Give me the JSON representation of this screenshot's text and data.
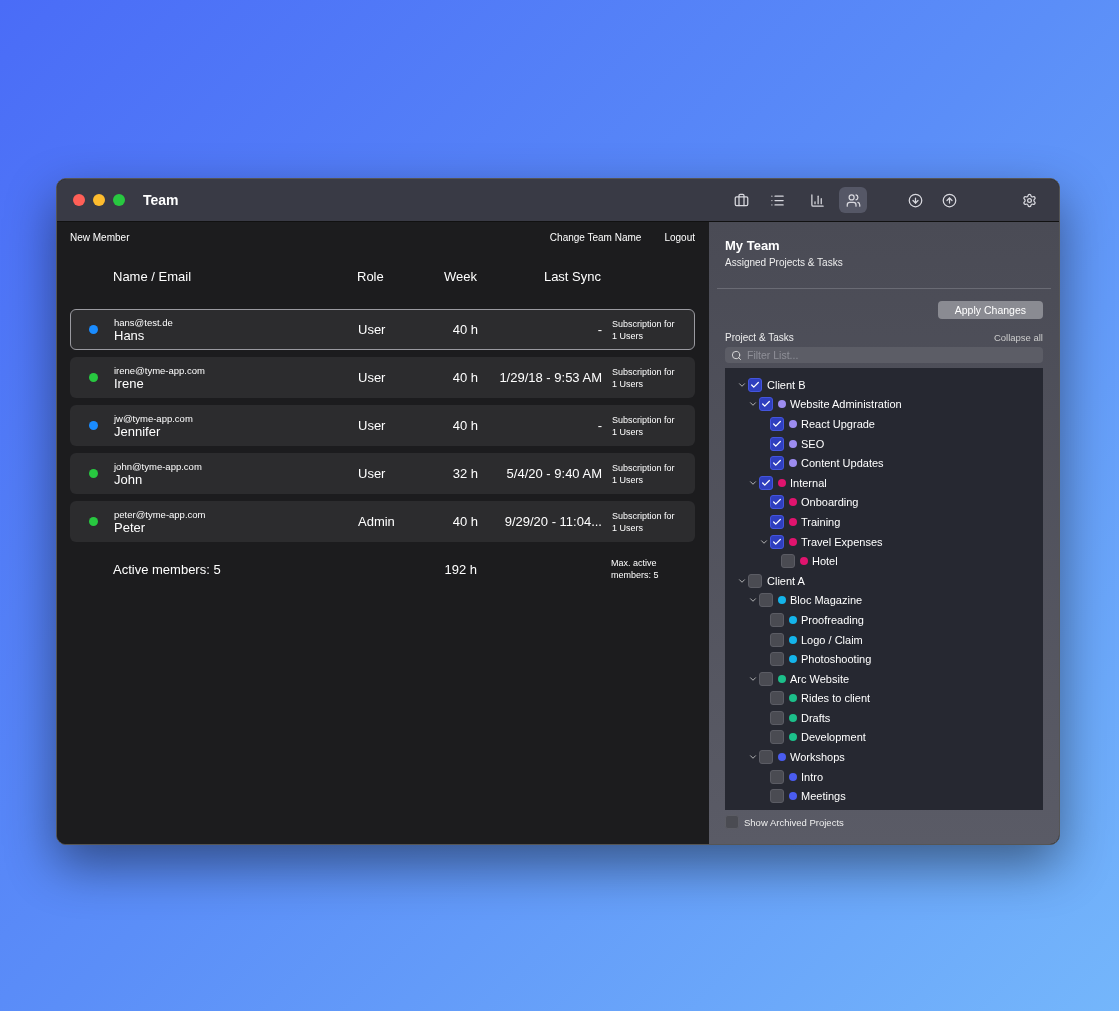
{
  "window": {
    "title": "Team"
  },
  "toolbar": [
    {
      "kind": "briefcase",
      "selected": false
    },
    {
      "kind": "list",
      "selected": false
    },
    {
      "kind": "chart",
      "selected": false
    },
    {
      "kind": "team",
      "selected": true
    },
    {
      "kind": "download",
      "selected": false
    },
    {
      "kind": "upload",
      "selected": false
    },
    {
      "kind": "settings",
      "selected": false
    }
  ],
  "team_actions": {
    "new_member": "New Member",
    "change_name": "Change Team Name",
    "logout": "Logout"
  },
  "table": {
    "columns": [
      "Name / Email",
      "Role",
      "Week",
      "Last Sync"
    ],
    "rows": [
      {
        "email": "hans@test.de",
        "name": "Hans",
        "role": "User",
        "week": "40 h",
        "last_sync": "-",
        "subscription": "Subscription for 1 Users",
        "color": "#1a8cff",
        "selected": true
      },
      {
        "email": "irene@tyme-app.com",
        "name": "Irene",
        "role": "User",
        "week": "40 h",
        "last_sync": "1/29/18 - 9:53 AM",
        "subscription": "Subscription for 1 Users",
        "color": "#28c840",
        "selected": false
      },
      {
        "email": "jw@tyme-app.com",
        "name": "Jennifer",
        "role": "User",
        "week": "40 h",
        "last_sync": "-",
        "subscription": "Subscription for 1 Users",
        "color": "#1a8cff",
        "selected": false
      },
      {
        "email": "john@tyme-app.com",
        "name": "John",
        "role": "User",
        "week": "32 h",
        "last_sync": "5/4/20 - 9:40 AM",
        "subscription": "Subscription for 1 Users",
        "color": "#28c840",
        "selected": false
      },
      {
        "email": "peter@tyme-app.com",
        "name": "Peter",
        "role": "Admin",
        "week": "40 h",
        "last_sync": "9/29/20 - 11:04...",
        "subscription": "Subscription for 1 Users",
        "color": "#28c840",
        "selected": false
      }
    ],
    "footer": {
      "active": "Active members: 5",
      "total": "192 h",
      "max": "Max. active members: 5"
    }
  },
  "sidebar": {
    "title": "My Team",
    "subtitle": "Assigned Projects & Tasks",
    "apply": "Apply Changes",
    "section": "Project & Tasks",
    "collapse": "Collapse all",
    "filter": {
      "placeholder": "Filter List..."
    },
    "tree": [
      {
        "label": "Client B",
        "checked": true,
        "expanded": true,
        "children": [
          {
            "label": "Website Administration",
            "checked": true,
            "color": "#9d8cf0",
            "expanded": true,
            "children": [
              {
                "label": "React Upgrade",
                "checked": true,
                "color": "#9d8cf0"
              },
              {
                "label": "SEO",
                "checked": true,
                "color": "#9d8cf0"
              },
              {
                "label": "Content Updates",
                "checked": true,
                "color": "#9d8cf0"
              }
            ]
          },
          {
            "label": "Internal",
            "checked": true,
            "color": "#e0146e",
            "expanded": true,
            "children": [
              {
                "label": "Onboarding",
                "checked": true,
                "color": "#e0146e"
              },
              {
                "label": "Training",
                "checked": true,
                "color": "#e0146e"
              },
              {
                "label": "Travel Expenses",
                "checked": true,
                "color": "#e0146e",
                "expanded": true,
                "children": [
                  {
                    "label": "Hotel",
                    "checked": false,
                    "color": "#e0146e"
                  }
                ]
              }
            ]
          }
        ]
      },
      {
        "label": "Client A",
        "checked": false,
        "expanded": true,
        "children": [
          {
            "label": "Bloc Magazine",
            "checked": false,
            "color": "#14b4ea",
            "expanded": true,
            "children": [
              {
                "label": "Proofreading",
                "checked": false,
                "color": "#14b4ea"
              },
              {
                "label": "Logo / Claim",
                "checked": false,
                "color": "#14b4ea"
              },
              {
                "label": "Photoshooting",
                "checked": false,
                "color": "#14b4ea"
              }
            ]
          },
          {
            "label": "Arc Website",
            "checked": false,
            "color": "#1cbf8a",
            "expanded": true,
            "children": [
              {
                "label": "Rides to client",
                "checked": false,
                "color": "#1cbf8a"
              },
              {
                "label": "Drafts",
                "checked": false,
                "color": "#1cbf8a"
              },
              {
                "label": "Development",
                "checked": false,
                "color": "#1cbf8a"
              }
            ]
          },
          {
            "label": "Workshops",
            "checked": false,
            "color": "#4a5cf0",
            "expanded": true,
            "children": [
              {
                "label": "Intro",
                "checked": false,
                "color": "#4a5cf0"
              },
              {
                "label": "Meetings",
                "checked": false,
                "color": "#4a5cf0"
              }
            ]
          }
        ]
      }
    ],
    "show_archived": {
      "label": "Show Archived Projects",
      "checked": false
    }
  }
}
